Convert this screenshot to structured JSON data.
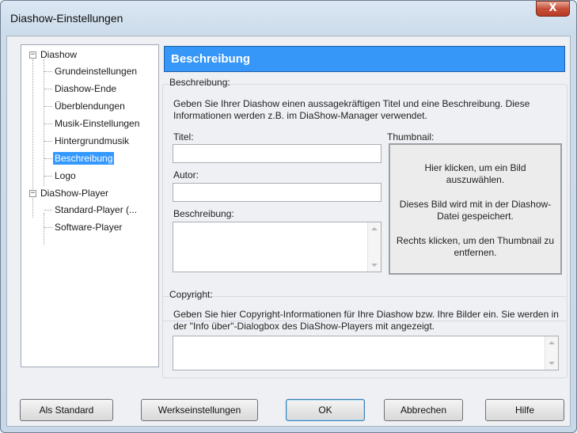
{
  "window": {
    "title": "Diashow-Einstellungen",
    "close_glyph": "X"
  },
  "tree": {
    "items": [
      {
        "label": "Diashow",
        "expander": "−"
      },
      {
        "label": "Grundeinstellungen"
      },
      {
        "label": "Diashow-Ende"
      },
      {
        "label": "Überblendungen"
      },
      {
        "label": "Musik-Einstellungen"
      },
      {
        "label": "Hintergrundmusik"
      },
      {
        "label": "Beschreibung"
      },
      {
        "label": "Logo"
      },
      {
        "label": "DiaShow-Player",
        "expander": "−"
      },
      {
        "label": "Standard-Player (..."
      },
      {
        "label": "Software-Player"
      }
    ]
  },
  "panel": {
    "header": "Beschreibung",
    "beschreibung_group": {
      "legend": "Beschreibung:",
      "info": "Geben Sie Ihrer Diashow einen aussagekräftigen Titel und eine Beschreibung. Diese Informationen werden z.B. im DiaShow-Manager verwendet.",
      "titel_label": "Titel:",
      "titel_value": "",
      "autor_label": "Autor:",
      "autor_value": "",
      "beschreibung_label": "Beschreibung:",
      "beschreibung_value": "",
      "thumbnail_label": "Thumbnail:",
      "thumbnail_hint_1": "Hier klicken, um ein Bild auszuwählen.",
      "thumbnail_hint_2": "Dieses Bild wird mit in der Diashow-Datei gespeichert.",
      "thumbnail_hint_3": "Rechts klicken, um den Thumbnail zu entfernen."
    },
    "copyright_group": {
      "legend": "Copyright:",
      "info": "Geben Sie hier Copyright-Informationen für Ihre Diashow bzw. Ihre Bilder ein. Sie werden in der \"Info über\"-Dialogbox des DiaShow-Players mit angezeigt.",
      "value": ""
    }
  },
  "buttons": {
    "als_standard": "Als Standard",
    "werkseinstellungen": "Werkseinstellungen",
    "ok": "OK",
    "abbrechen": "Abbrechen",
    "hilfe": "Hilfe"
  }
}
